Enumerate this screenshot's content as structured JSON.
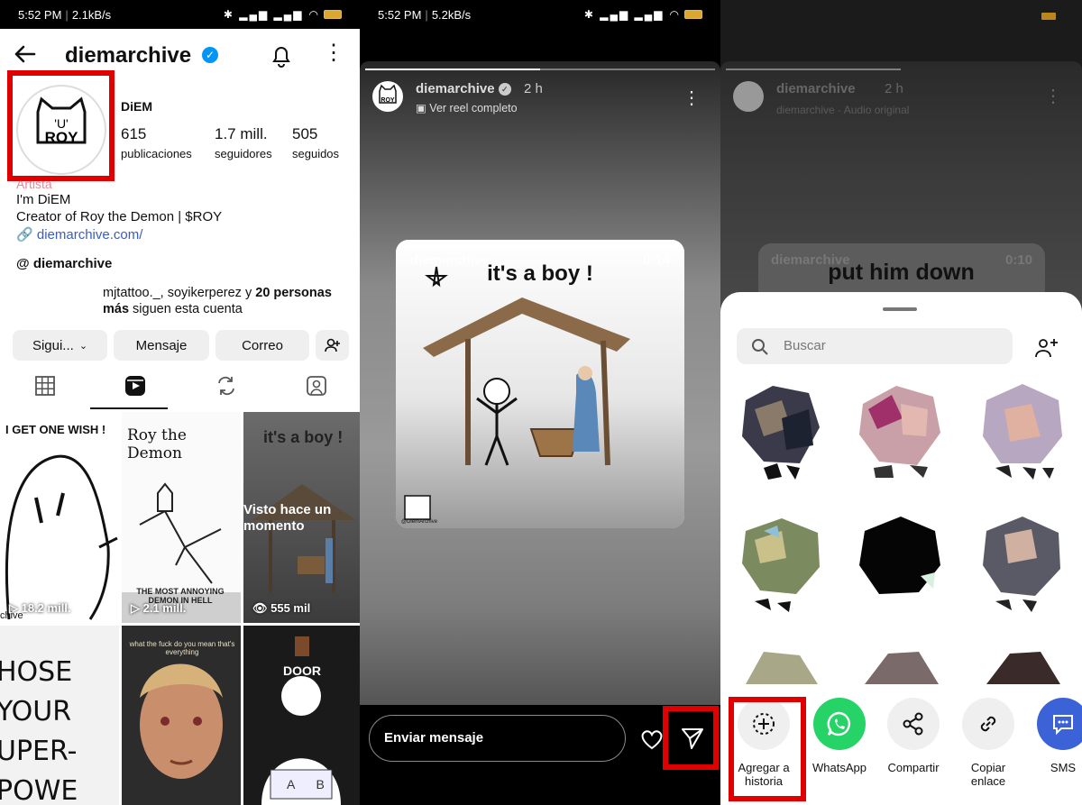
{
  "status": {
    "left": {
      "time": "5:52 PM",
      "speed": "2.1kB/s"
    },
    "middle": {
      "time": "5:52 PM",
      "speed": "5.2kB/s"
    }
  },
  "profile": {
    "username": "diemarchive",
    "display_name": "DiEM",
    "avatar_text": "ROY",
    "stats": [
      {
        "value": "615",
        "label": "publicaciones"
      },
      {
        "value": "1.7 mill.",
        "label": "seguidores"
      },
      {
        "value": "505",
        "label": "seguidos"
      }
    ],
    "category": "Artista",
    "bio_line1": "I'm DiEM",
    "bio_line2": "Creator of Roy the Demon | $ROY",
    "link": "diemarchive.com/",
    "threads_handle": "diemarchive",
    "followed_by_prefix": "mjtattoo._, soyikerperez y ",
    "followed_by_bold": "20 personas más",
    "followed_by_suffix": " siguen esta cuenta",
    "buttons": {
      "follow": "Sigui...",
      "message": "Mensaje",
      "email": "Correo"
    },
    "grid": [
      {
        "title": "I GET ONE WISH !",
        "views": "18.2 mill.",
        "extra": "chive"
      },
      {
        "title": "Roy the Demon",
        "views": "2.1 mill.",
        "caption": "THE MOST ANNOYING DEMON IN HELL"
      },
      {
        "title": "it's a boy !",
        "views": "555 mil",
        "overlay": "Visto hace un momento"
      },
      {
        "title": "HOSE YOUR UPER-POWE"
      },
      {
        "title": "what the fuck do you mean that's everything"
      },
      {
        "title": "DOOR",
        "letters": "A B"
      }
    ]
  },
  "story": {
    "username": "diemarchive",
    "time": "2 h",
    "subtitle": "Ver reel completo",
    "reel_user": "diemarchive",
    "reel_duration": "0:14",
    "reel_title": "it's a boy !",
    "watermark": "@DiemArchive",
    "message_placeholder": "Enviar mensaje"
  },
  "share": {
    "bg_username": "diemarchive",
    "bg_time": "2 h",
    "bg_subtitle": "diemarchive · Audio original",
    "bg_reel_user": "diemarchive",
    "bg_reel_duration": "0:10",
    "bg_title": "put him down",
    "search_placeholder": "Buscar",
    "targets": [
      {
        "label1": "Agregar a",
        "label2": "historia"
      },
      {
        "label1": "WhatsApp",
        "label2": ""
      },
      {
        "label1": "Compartir",
        "label2": ""
      },
      {
        "label1": "Copiar",
        "label2": "enlace"
      },
      {
        "label1": "SMS",
        "label2": ""
      }
    ]
  }
}
